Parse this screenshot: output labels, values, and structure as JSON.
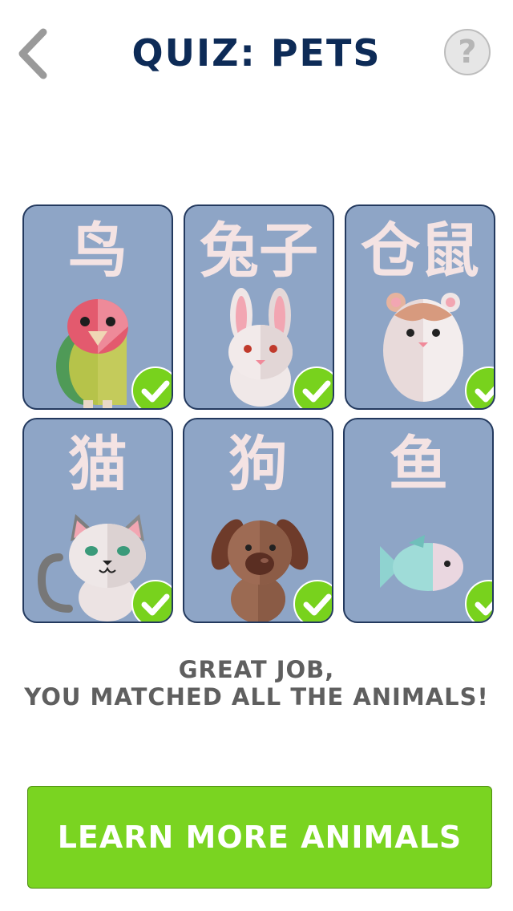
{
  "header": {
    "title": "QUIZ: PETS",
    "help_label": "?"
  },
  "cards": [
    {
      "word": "鸟",
      "animal": "bird-illustration",
      "matched": true
    },
    {
      "word": "兔子",
      "animal": "rabbit-illustration",
      "matched": true
    },
    {
      "word": "仓鼠",
      "animal": "hamster-illustration",
      "matched": true
    },
    {
      "word": "猫",
      "animal": "cat-illustration",
      "matched": true
    },
    {
      "word": "狗",
      "animal": "dog-illustration",
      "matched": true
    },
    {
      "word": "鱼",
      "animal": "fish-illustration",
      "matched": true
    }
  ],
  "message": {
    "line1": "GREAT JOB,",
    "line2": "YOU MATCHED ALL THE ANIMALS!"
  },
  "cta": {
    "label": "LEARN MORE ANIMALS"
  },
  "colors": {
    "title": "#0d2b57",
    "card_bg": "#8ea5c6",
    "card_border": "#23395e",
    "check_green": "#78d21d",
    "cta_green": "#7ad421",
    "message_gray": "#5f5f5f"
  }
}
